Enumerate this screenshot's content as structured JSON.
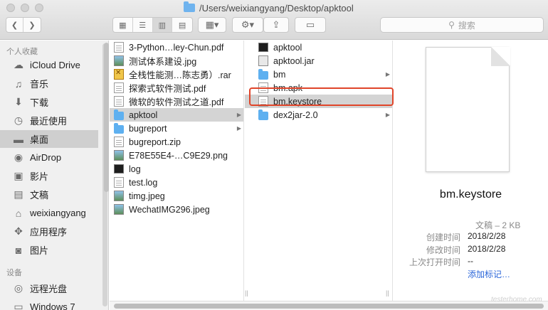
{
  "window": {
    "path_title": "/Users/weixiangyang/Desktop/apktool",
    "search_placeholder": "搜索"
  },
  "sidebar": {
    "sections": [
      {
        "header": "个人收藏",
        "items": [
          {
            "label": "iCloud Drive",
            "icon": "cloud-icon"
          },
          {
            "label": "音乐",
            "icon": "music-icon"
          },
          {
            "label": "下载",
            "icon": "download-icon"
          },
          {
            "label": "最近使用",
            "icon": "clock-icon"
          },
          {
            "label": "桌面",
            "icon": "desktop-icon",
            "selected": true
          },
          {
            "label": "AirDrop",
            "icon": "airdrop-icon"
          },
          {
            "label": "影片",
            "icon": "film-icon"
          },
          {
            "label": "文稿",
            "icon": "document-icon"
          },
          {
            "label": "weixiangyang",
            "icon": "home-icon"
          },
          {
            "label": "应用程序",
            "icon": "apps-icon"
          },
          {
            "label": "图片",
            "icon": "camera-icon"
          }
        ]
      },
      {
        "header": "设备",
        "items": [
          {
            "label": "远程光盘",
            "icon": "disc-icon"
          },
          {
            "label": "Windows 7",
            "icon": "disk-icon"
          }
        ]
      }
    ]
  },
  "column1": {
    "items": [
      {
        "name": "3-Python…ley-Chun.pdf",
        "icon": "pdf"
      },
      {
        "name": "测试体系建设.jpg",
        "icon": "img"
      },
      {
        "name": "全栈性能测…陈志勇）.rar",
        "icon": "rar"
      },
      {
        "name": "探索式软件测试.pdf",
        "icon": "pdf"
      },
      {
        "name": "微软的软件测试之道.pdf",
        "icon": "pdf"
      },
      {
        "name": "apktool",
        "icon": "folder",
        "selected": true,
        "has_children": true
      },
      {
        "name": "bugreport",
        "icon": "folder",
        "has_children": true
      },
      {
        "name": "bugreport.zip",
        "icon": "doc"
      },
      {
        "name": "E78E55E4-…C9E29.png",
        "icon": "img"
      },
      {
        "name": "log",
        "icon": "term"
      },
      {
        "name": "test.log",
        "icon": "doc"
      },
      {
        "name": "timg.jpeg",
        "icon": "img"
      },
      {
        "name": "WechatIMG296.jpeg",
        "icon": "img"
      }
    ]
  },
  "column2": {
    "items": [
      {
        "name": "apktool",
        "icon": "term"
      },
      {
        "name": "apktool.jar",
        "icon": "jar"
      },
      {
        "name": "bm",
        "icon": "folder",
        "has_children": true
      },
      {
        "name": "bm.apk",
        "icon": "doc"
      },
      {
        "name": "bm.keystore",
        "icon": "doc",
        "selected": true
      },
      {
        "name": "dex2jar-2.0",
        "icon": "folder",
        "has_children": true
      }
    ]
  },
  "preview": {
    "filename": "bm.keystore",
    "kind_size": "文稿 – 2 KB",
    "fields": [
      {
        "label": "创建时间",
        "value": "2018/2/28"
      },
      {
        "label": "修改时间",
        "value": "2018/2/28"
      },
      {
        "label": "上次打开时间",
        "value": "--"
      }
    ],
    "add_tags": "添加标记…"
  },
  "watermark": "testerhome.com"
}
